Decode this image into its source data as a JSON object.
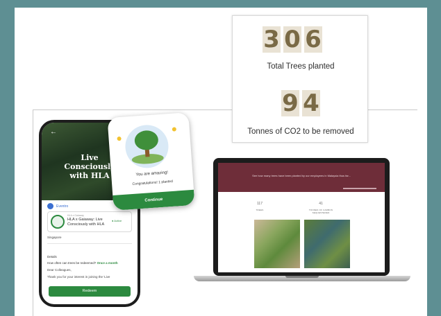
{
  "stats": {
    "trees_digits": [
      "3",
      "0",
      "6"
    ],
    "trees_label": "Total Trees planted",
    "co2_digits": [
      "9",
      "4"
    ],
    "co2_label": "Tonnes of CO2 to be removed"
  },
  "phone": {
    "back_icon": "←",
    "hero_title_lines": [
      "Live",
      "Consciously",
      "with HLA"
    ],
    "org_name": "Eventro",
    "event_label": "HLA x Gaiaway",
    "event_name": "HLA x Gaiaway: Live Consciously with HLA",
    "event_status": "● Active",
    "location": "Singapore",
    "details_title": "Details",
    "redeem_question": "How often can trees be redeemed?",
    "redeem_answer": "Once a month",
    "greeting": "Dear Colleagues,",
    "thanks": "Thank you for your interest in joining the 'Live",
    "redeem_button": "Redeem"
  },
  "popup": {
    "title": "You are amazing!",
    "subtitle": "Congratulations! 1 planted",
    "continue_button": "Continue"
  },
  "laptop": {
    "banner_text": "See how many trees have been planted by our employees in Malaysia thus far...",
    "metric1_value": "117",
    "metric1_label": "TREES",
    "metric2_value": "41",
    "metric2_label": "TONNES OF CARBON SEQUESTERED"
  },
  "colors": {
    "background": "#5e8f93",
    "digit_tile": "#e9e2d4",
    "digit_text": "#7a6a46",
    "brand_green": "#2c8a3f",
    "laptop_banner": "#6e2d39"
  }
}
